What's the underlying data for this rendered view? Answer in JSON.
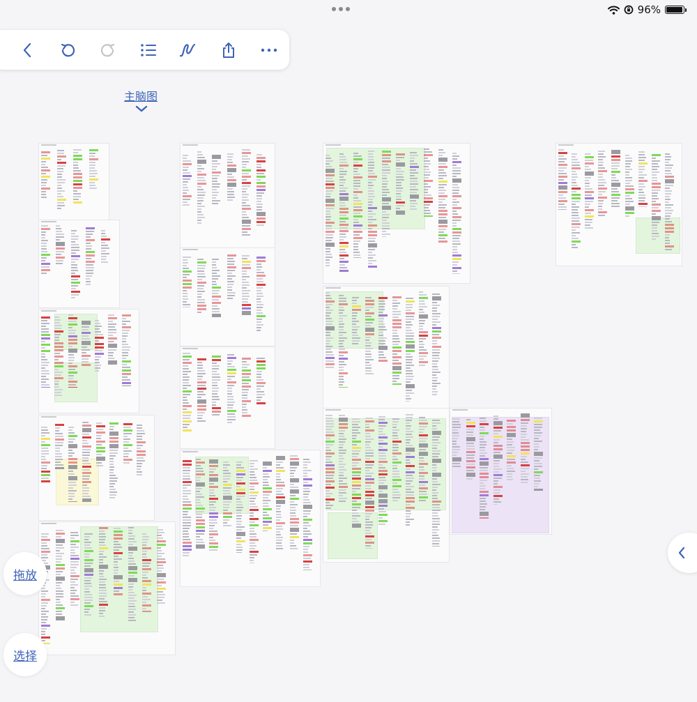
{
  "status_bar": {
    "battery_text": "96%",
    "battery_level": 0.96,
    "icons": [
      "wifi-icon",
      "orientation-lock-icon",
      "battery-icon"
    ]
  },
  "toolbar": {
    "buttons": [
      {
        "name": "back-button",
        "icon": "chevron-left-icon",
        "enabled": true
      },
      {
        "name": "undo-button",
        "icon": "undo-icon",
        "enabled": true
      },
      {
        "name": "redo-button",
        "icon": "redo-icon",
        "enabled": false
      },
      {
        "name": "outline-button",
        "icon": "list-icon",
        "enabled": true
      },
      {
        "name": "draw-button",
        "icon": "squiggle-pen-icon",
        "enabled": true
      },
      {
        "name": "share-button",
        "icon": "share-icon",
        "enabled": true
      },
      {
        "name": "more-button",
        "icon": "ellipsis-icon",
        "enabled": true
      }
    ]
  },
  "map": {
    "title": "主脑图"
  },
  "side_actions": {
    "drag_label": "拖放",
    "select_label": "选择"
  },
  "colors": {
    "accent": "#3d63b8",
    "green": "#7ed957",
    "purple": "#a07ad6",
    "red": "#d84141",
    "yellow": "#f1e35a",
    "green_bg": "#e3f5dc",
    "purple_bg": "#ece3f6",
    "yellow_bg": "#fbf8d8"
  }
}
